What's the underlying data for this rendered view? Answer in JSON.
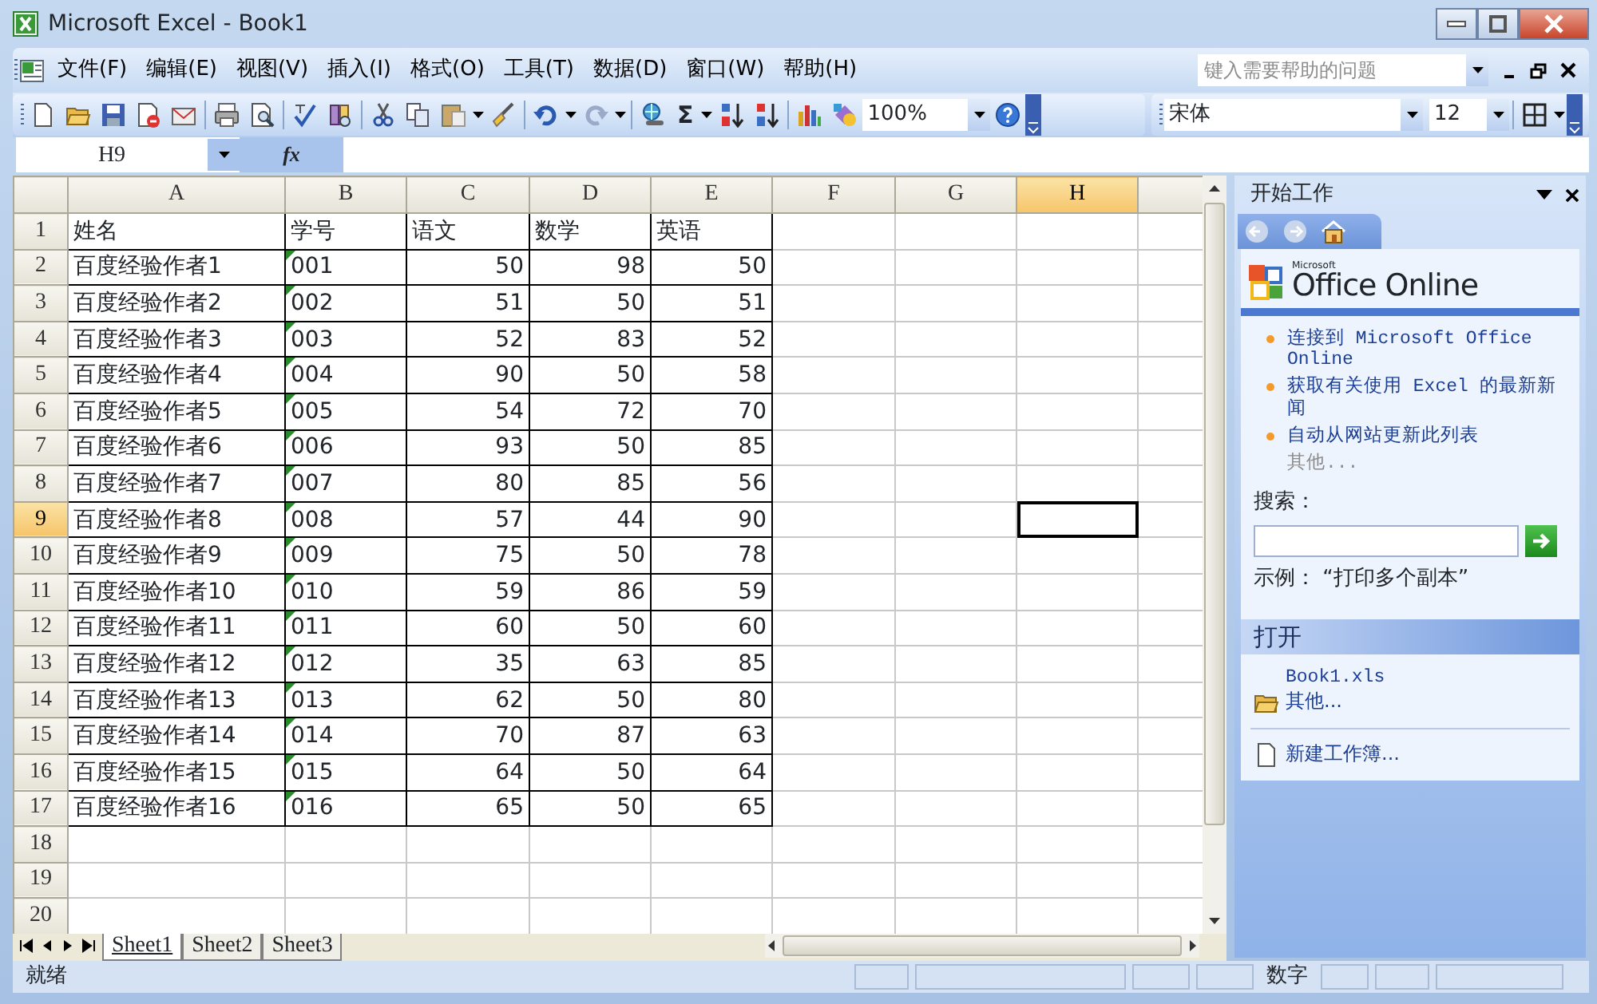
{
  "window": {
    "title": "Microsoft Excel - Book1"
  },
  "menu": [
    "文件(F)",
    "编辑(E)",
    "视图(V)",
    "插入(I)",
    "格式(O)",
    "工具(T)",
    "数据(D)",
    "窗口(W)",
    "帮助(H)"
  ],
  "help_search": {
    "placeholder": "键入需要帮助的问题"
  },
  "toolbar": {
    "autosum": "Σ",
    "zoom": "100%",
    "font": "宋体",
    "font_size": "12"
  },
  "formula_bar": {
    "name_box": "H9",
    "function_label": "fx"
  },
  "sheet": {
    "columns": [
      {
        "label": "A",
        "selected": false,
        "kind": "text"
      },
      {
        "label": "B",
        "selected": false,
        "kind": "text_number"
      },
      {
        "label": "C",
        "selected": false,
        "kind": "number"
      },
      {
        "label": "D",
        "selected": false,
        "kind": "number"
      },
      {
        "label": "E",
        "selected": false,
        "kind": "number"
      },
      {
        "label": "F",
        "selected": false
      },
      {
        "label": "G",
        "selected": false
      },
      {
        "label": "H",
        "selected": true
      }
    ],
    "rows": [
      {
        "label": "1",
        "selected": false,
        "kind": "header",
        "cells": [
          "姓名",
          "学号",
          "语文",
          "数学",
          "英语"
        ]
      },
      {
        "label": "2",
        "selected": false,
        "kind": "record",
        "cells": [
          "百度经验作者1",
          "001",
          "50",
          "98",
          "50"
        ]
      },
      {
        "label": "3",
        "selected": false,
        "kind": "record",
        "cells": [
          "百度经验作者2",
          "002",
          "51",
          "50",
          "51"
        ]
      },
      {
        "label": "4",
        "selected": false,
        "kind": "record",
        "cells": [
          "百度经验作者3",
          "003",
          "52",
          "83",
          "52"
        ]
      },
      {
        "label": "5",
        "selected": false,
        "kind": "record",
        "cells": [
          "百度经验作者4",
          "004",
          "90",
          "50",
          "58"
        ]
      },
      {
        "label": "6",
        "selected": false,
        "kind": "record",
        "cells": [
          "百度经验作者5",
          "005",
          "54",
          "72",
          "70"
        ]
      },
      {
        "label": "7",
        "selected": false,
        "kind": "record",
        "cells": [
          "百度经验作者6",
          "006",
          "93",
          "50",
          "85"
        ]
      },
      {
        "label": "8",
        "selected": false,
        "kind": "record",
        "cells": [
          "百度经验作者7",
          "007",
          "80",
          "85",
          "56"
        ]
      },
      {
        "label": "9",
        "selected": true,
        "kind": "record",
        "cells": [
          "百度经验作者8",
          "008",
          "57",
          "44",
          "90"
        ]
      },
      {
        "label": "10",
        "selected": false,
        "kind": "record",
        "cells": [
          "百度经验作者9",
          "009",
          "75",
          "50",
          "78"
        ]
      },
      {
        "label": "11",
        "selected": false,
        "kind": "record",
        "cells": [
          "百度经验作者10",
          "010",
          "59",
          "86",
          "59"
        ]
      },
      {
        "label": "12",
        "selected": false,
        "kind": "record",
        "cells": [
          "百度经验作者11",
          "011",
          "60",
          "50",
          "60"
        ]
      },
      {
        "label": "13",
        "selected": false,
        "kind": "record",
        "cells": [
          "百度经验作者12",
          "012",
          "35",
          "63",
          "85"
        ]
      },
      {
        "label": "14",
        "selected": false,
        "kind": "record",
        "cells": [
          "百度经验作者13",
          "013",
          "62",
          "50",
          "80"
        ]
      },
      {
        "label": "15",
        "selected": false,
        "kind": "record",
        "cells": [
          "百度经验作者14",
          "014",
          "70",
          "87",
          "63"
        ]
      },
      {
        "label": "16",
        "selected": false,
        "kind": "record",
        "cells": [
          "百度经验作者15",
          "015",
          "64",
          "50",
          "64"
        ]
      },
      {
        "label": "17",
        "selected": false,
        "kind": "record",
        "cells": [
          "百度经验作者16",
          "016",
          "65",
          "50",
          "65"
        ]
      },
      {
        "label": "18",
        "selected": false,
        "kind": "empty"
      },
      {
        "label": "19",
        "selected": false,
        "kind": "empty"
      },
      {
        "label": "20",
        "selected": false,
        "kind": "empty"
      }
    ]
  },
  "sheet_tabs": [
    {
      "label": "Sheet1",
      "selected": true
    },
    {
      "label": "Sheet2",
      "selected": false
    },
    {
      "label": "Sheet3",
      "selected": false
    }
  ],
  "task_pane": {
    "title": "开始工作",
    "logo": {
      "small": "Microsoft",
      "text": "Office Online"
    },
    "links": [
      {
        "label": "连接到 Microsoft Office Online",
        "disabled": false
      },
      {
        "label": "获取有关使用 Excel 的最新新闻",
        "disabled": false
      },
      {
        "label": "自动从网站更新此列表",
        "disabled": false
      },
      {
        "label": "其他...",
        "disabled": true
      }
    ],
    "search": {
      "label": "搜索：",
      "example": "示例：  “打印多个副本”"
    },
    "open_section": {
      "title": "打开",
      "files": [
        {
          "label": "Book1.xls",
          "kind": "file"
        },
        {
          "label": "其他...",
          "kind": "folder"
        }
      ]
    },
    "new_workbook": "新建工作簿..."
  },
  "status_bar": {
    "text": "就绪",
    "indicators": [
      "数字"
    ]
  }
}
